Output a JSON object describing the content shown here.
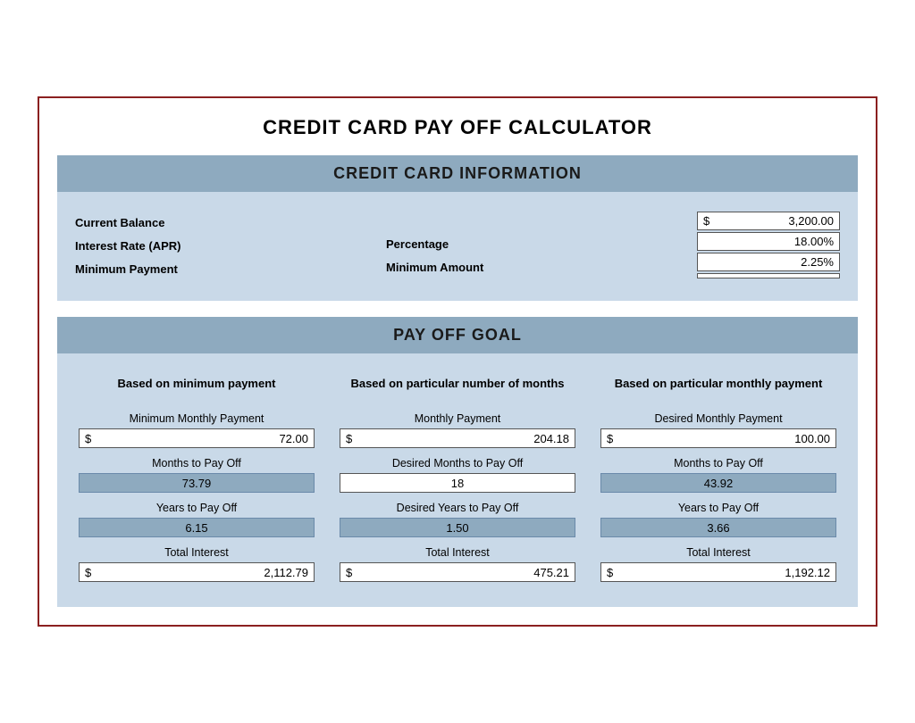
{
  "title": "CREDIT CARD PAY OFF CALCULATOR",
  "credit_card_section": {
    "header": "CREDIT CARD INFORMATION",
    "labels": [
      "Current Balance",
      "Interest Rate (APR)",
      "Minimum Payment"
    ],
    "mid_labels": [
      "Percentage",
      "Minimum Amount"
    ],
    "values": [
      {
        "prefix": "$",
        "value": "3,200.00"
      },
      {
        "prefix": "",
        "value": "18.00%"
      },
      {
        "prefix": "",
        "value": "2.25%"
      },
      {
        "prefix": "",
        "value": ""
      }
    ]
  },
  "payoff_section": {
    "header": "PAY OFF GOAL",
    "columns": [
      {
        "header": "Based on minimum payment",
        "fields": [
          {
            "label": "Minimum Monthly Payment",
            "type": "input",
            "prefix": "$",
            "value": "72.00"
          },
          {
            "label": "Months to Pay Off",
            "type": "result",
            "value": "73.79"
          },
          {
            "label": "Years to Pay Off",
            "type": "result",
            "value": "6.15"
          },
          {
            "label": "Total Interest",
            "type": "input",
            "prefix": "$",
            "value": "2,112.79"
          }
        ]
      },
      {
        "header": "Based on particular number of months",
        "fields": [
          {
            "label": "Monthly Payment",
            "type": "input",
            "prefix": "$",
            "value": "204.18"
          },
          {
            "label": "Desired Months to Pay Off",
            "type": "result-white",
            "value": "18"
          },
          {
            "label": "Desired Years to Pay Off",
            "type": "result",
            "value": "1.50"
          },
          {
            "label": "Total Interest",
            "type": "input",
            "prefix": "$",
            "value": "475.21"
          }
        ]
      },
      {
        "header": "Based on particular monthly payment",
        "fields": [
          {
            "label": "Desired Monthly Payment",
            "type": "input",
            "prefix": "$",
            "value": "100.00"
          },
          {
            "label": "Months to Pay Off",
            "type": "result",
            "value": "43.92"
          },
          {
            "label": "Years to Pay Off",
            "type": "result",
            "value": "3.66"
          },
          {
            "label": "Total Interest",
            "type": "input",
            "prefix": "$",
            "value": "1,192.12"
          }
        ]
      }
    ]
  }
}
